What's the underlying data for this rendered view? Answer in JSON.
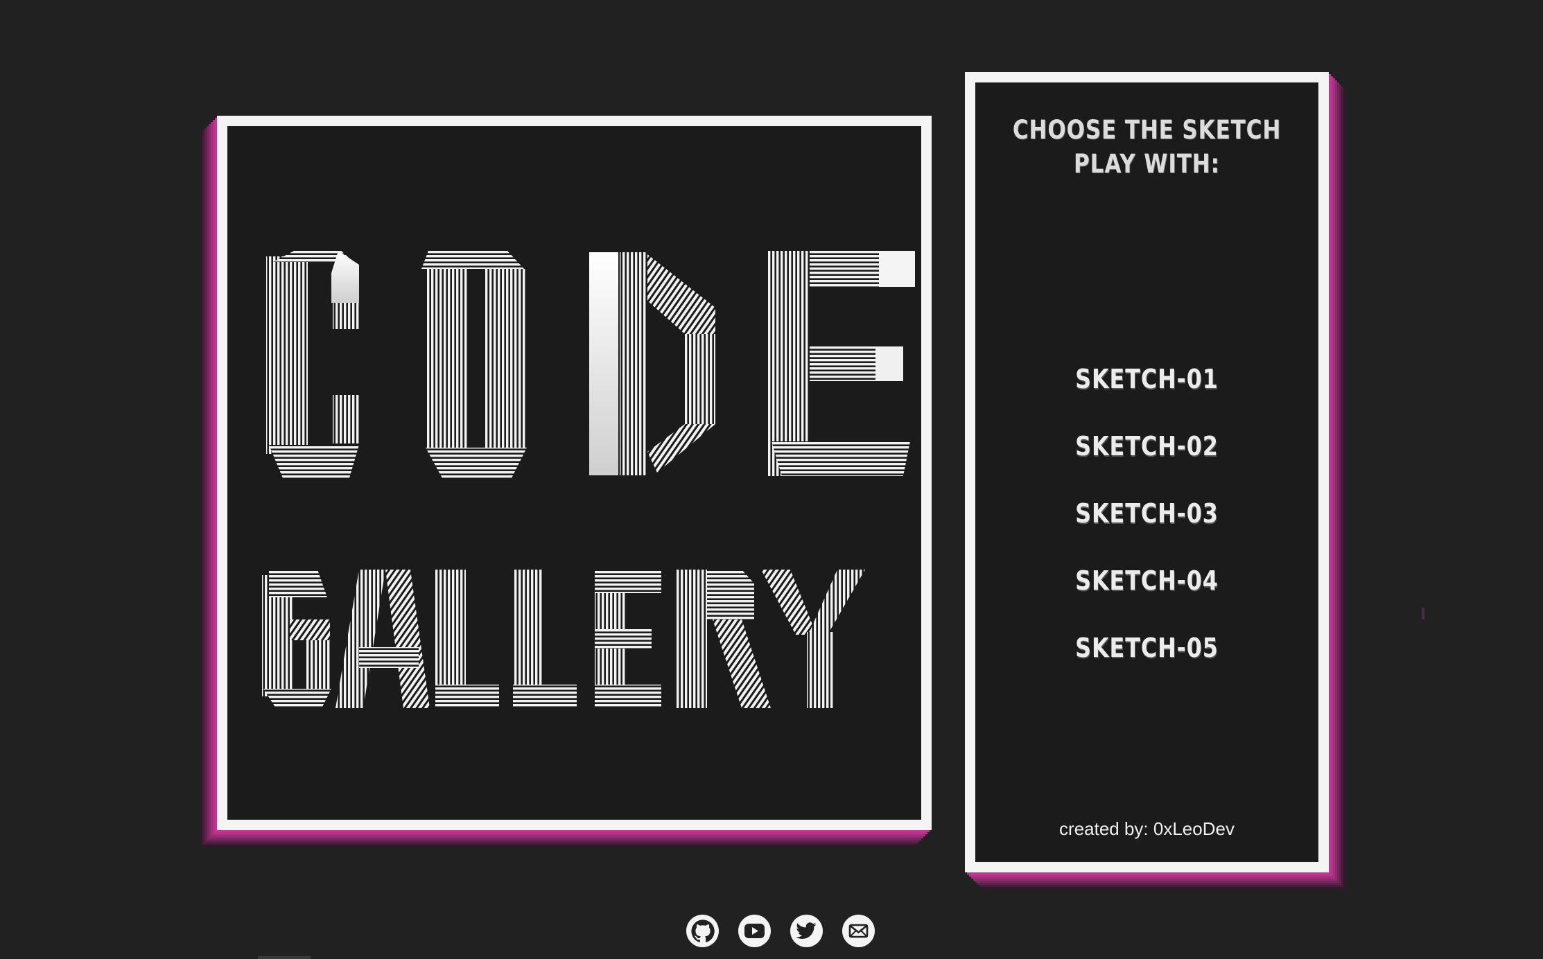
{
  "canvas": {
    "art_lines": [
      "CODE",
      "GALLERY"
    ]
  },
  "panel": {
    "title_line1": "CHOOSE THE SKETCH",
    "title_line2": "PLAY WITH:",
    "sketches": [
      "SKETCH-01",
      "SKETCH-02",
      "SKETCH-03",
      "SKETCH-04",
      "SKETCH-05"
    ],
    "credit": "created by: 0xLeoDev"
  },
  "socials": [
    {
      "icon": "github-icon"
    },
    {
      "icon": "youtube-icon"
    },
    {
      "icon": "twitter-icon"
    },
    {
      "icon": "mail-icon"
    }
  ],
  "colors": {
    "background": "#212121",
    "frame": "#f4f4f4",
    "accent_shadow": "#c0388f",
    "panel_bg": "#1b1b1b"
  }
}
